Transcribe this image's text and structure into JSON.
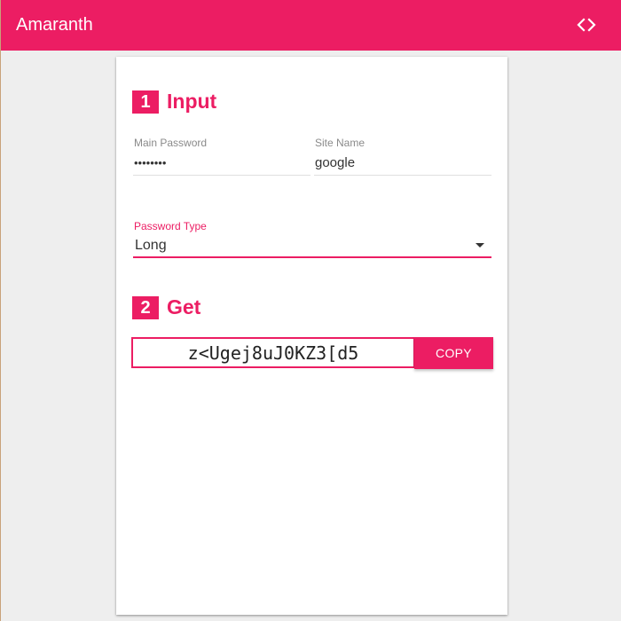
{
  "app": {
    "title": "Amaranth",
    "code_icon": "code-icon",
    "accent_color": "#ec1d63"
  },
  "step1": {
    "number": "1",
    "title": "Input"
  },
  "main_password": {
    "label": "Main Password",
    "value": "••••••••"
  },
  "site_name": {
    "label": "Site Name",
    "value": "google"
  },
  "password_type": {
    "label": "Password Type",
    "selected": "Long",
    "arrow_icon": "dropdown-arrow-icon"
  },
  "step2": {
    "number": "2",
    "title": "Get"
  },
  "output": {
    "password": "z<Ugej8uJ0KZ3[d5",
    "copy_label": "COPY"
  }
}
